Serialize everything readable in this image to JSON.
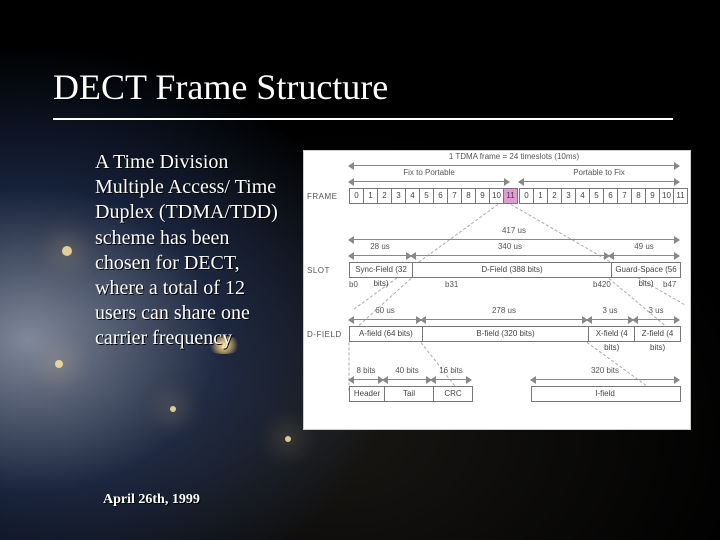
{
  "title": "DECT Frame Structure",
  "body_text": "A Time Division Multiple Access/ Time Duplex (TDMA/TDD) scheme has been chosen for DECT, where a total of 12 users can share one carrier frequency",
  "footer_date": "April 26th, 1999",
  "diagram": {
    "top_caption": "1 TDMA frame = 24 timeslots (10ms)",
    "frame_label": "FRAME",
    "slot_label": "SLOT",
    "dfield_label": "D-FIELD",
    "tx_label": "Fix to Portable",
    "rx_label": "Portable to Fix",
    "tx_slots": [
      "0",
      "1",
      "2",
      "3",
      "4",
      "5",
      "6",
      "7",
      "8",
      "9",
      "10",
      "11"
    ],
    "rx_slots": [
      "0",
      "1",
      "2",
      "3",
      "4",
      "5",
      "6",
      "7",
      "8",
      "9",
      "10",
      "11"
    ],
    "highlight_tx_index": 11,
    "total_us": "417 us",
    "sync_us": "28 us",
    "dfield_us": "340 us",
    "guard_us": "49 us",
    "sync_field": "Sync-Field (32 bits)",
    "d_field": "D-Field (388 bits)",
    "guard_field": "Guard-Space (56 bits)",
    "bit_b0": "b0",
    "bit_b31": "b31",
    "bit_b420": "b420",
    "bit_b47": "b47",
    "a_us": "60 us",
    "b_us": "278 us",
    "x_us": "3 us",
    "z_us": "3 us",
    "a_field": "A-field (64 bits)",
    "b_field": "B-field (320 bits)",
    "x_field": "X-field (4 bits)",
    "z_field": "Z-field (4 bits)",
    "afield_parts": {
      "header_bits": "8 bits",
      "tail_bits": "40 bits",
      "crc_bits": "16 bits",
      "header": "Header",
      "tail": "Tail",
      "crc": "CRC",
      "ifield_bits": "320 bits",
      "ifield": "I-field"
    }
  }
}
